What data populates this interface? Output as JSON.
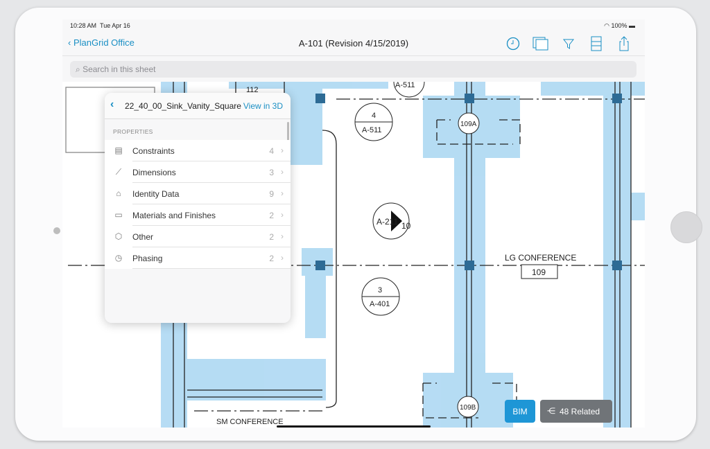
{
  "status_bar": {
    "time": "10:28 AM",
    "date": "Tue Apr 16",
    "battery": "100%"
  },
  "nav": {
    "back_label": "PlanGrid Office",
    "title": "A-101 (Revision 4/15/2019)",
    "icons": [
      "history-icon",
      "layers-icon",
      "filter-icon",
      "cabinet-icon",
      "share-icon"
    ]
  },
  "search": {
    "placeholder": "Search in this sheet"
  },
  "popover": {
    "title": "22_40_00_Sink_Vanity_Square",
    "view_3d": "View in 3D",
    "section": "PROPERTIES",
    "items": [
      {
        "label": "Constraints",
        "count": "4",
        "icon": "document-icon"
      },
      {
        "label": "Dimensions",
        "count": "3",
        "icon": "ruler-icon"
      },
      {
        "label": "Identity Data",
        "count": "9",
        "icon": "building-icon"
      },
      {
        "label": "Materials and Finishes",
        "count": "2",
        "icon": "material-icon"
      },
      {
        "label": "Other",
        "count": "2",
        "icon": "cube-icon"
      },
      {
        "label": "Phasing",
        "count": "2",
        "icon": "clock-history-icon"
      }
    ]
  },
  "plan": {
    "room_112": "112",
    "tag_a511_top": "A-511",
    "tag_4_num": "4",
    "tag_4_sheet": "A-511",
    "door_109a": "109A",
    "tag_a211": "A-211",
    "tag_a211_num": "10",
    "room_lg": "LG CONFERENCE",
    "room_lg_num": "109",
    "tag_3_num": "3",
    "tag_3_sheet": "A-401",
    "door_109b": "109B",
    "room_sm": "SM CONFERENCE"
  },
  "buttons": {
    "bim": "BIM",
    "related": "48 Related"
  },
  "colors": {
    "accent": "#1a8fc4",
    "bim_blue": "#1e96d6",
    "highlight": "#a9d6f2"
  }
}
